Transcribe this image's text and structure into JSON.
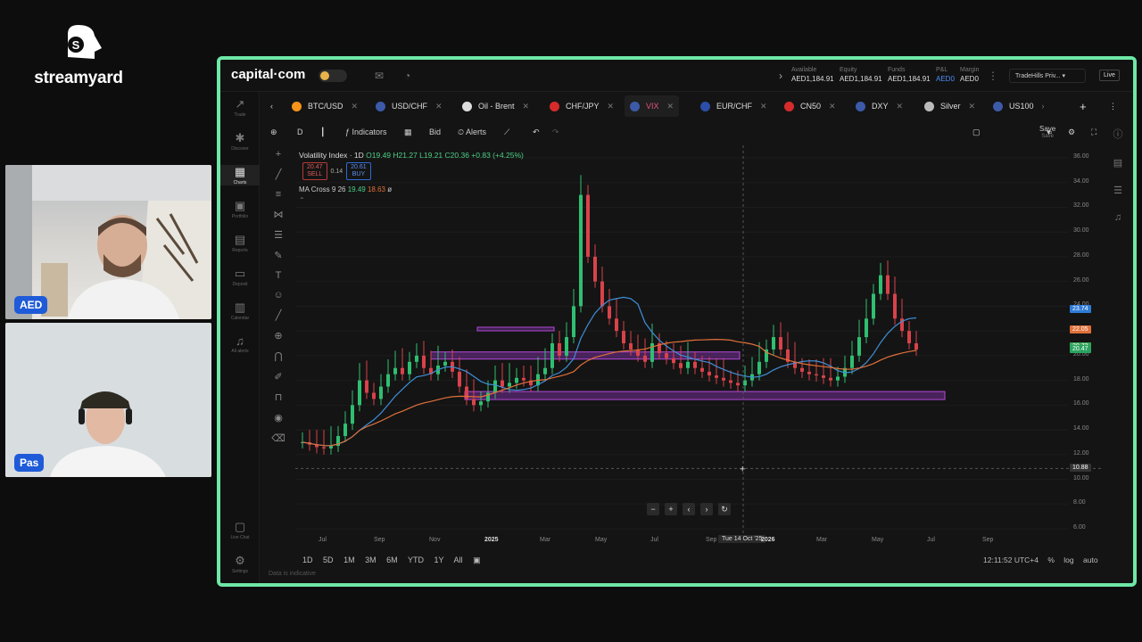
{
  "streamyard": {
    "brand_text": "streamyard",
    "participants": [
      {
        "badge": "AED"
      },
      {
        "badge": "Pas"
      }
    ]
  },
  "app": {
    "brand": "capital·com",
    "account": {
      "available_label": "Available",
      "available_value": "AED1,184.91",
      "equity_label": "Equity",
      "equity_value": "AED1,184.91",
      "funds_label": "Funds",
      "funds_value": "AED1,184.91",
      "pnl_label": "P&L",
      "pnl_value": "AED0",
      "margin_label": "Margin",
      "margin_value": "AED0"
    },
    "account_selector": "TradeHills Priv...",
    "live_badge": "Live"
  },
  "sidebar": {
    "items": [
      {
        "label": "Trade",
        "icon": "trend-up-icon"
      },
      {
        "label": "Discover",
        "icon": "network-icon"
      },
      {
        "label": "Charts",
        "icon": "charts-icon"
      },
      {
        "label": "Portfolio",
        "icon": "briefcase-icon"
      },
      {
        "label": "Reports",
        "icon": "report-icon"
      },
      {
        "label": "Deposit",
        "icon": "wallet-icon"
      },
      {
        "label": "Calendar",
        "icon": "calendar-icon"
      },
      {
        "label": "All alerts",
        "icon": "bell-icon"
      },
      {
        "label": "Live Chat",
        "icon": "chat-icon"
      },
      {
        "label": "Settings",
        "icon": "gear-icon"
      }
    ]
  },
  "tabs": [
    {
      "label": "BTC/USD",
      "color": "#f7931a"
    },
    {
      "label": "USD/CHF",
      "color": "#3c5aa8"
    },
    {
      "label": "Oil - Brent",
      "color": "#dddddd"
    },
    {
      "label": "CHF/JPY",
      "color": "#d62b2b"
    },
    {
      "label": "VIX",
      "color": "#3c5aa8"
    },
    {
      "label": "EUR/CHF",
      "color": "#2c4ea8"
    },
    {
      "label": "CN50",
      "color": "#d62b2b"
    },
    {
      "label": "DXY",
      "color": "#3c5aa8"
    },
    {
      "label": "Silver",
      "color": "#bbbbbb"
    },
    {
      "label": "US100",
      "color": "#3c5aa8"
    }
  ],
  "toolbar": {
    "interval": "D",
    "indicators": "Indicators",
    "price_type": "Bid",
    "alerts": "Alerts",
    "save": "Save",
    "save_sub": "Save"
  },
  "legend": {
    "title": "Volatility Index · 1D",
    "ohlc": "O19.49 H21.27 L19.21 C20.36 +0.83 (+4.25%)",
    "sell_price": "20.47",
    "sell_label": "SELL",
    "spread": "0.14",
    "buy_price": "20.61",
    "buy_label": "BUY",
    "ma_label": "MA Cross 9 26",
    "ma_fast": "19.49",
    "ma_slow": "18.63"
  },
  "chart_data": {
    "type": "candlestick",
    "instrument": "Volatility Index",
    "interval": "1D",
    "y_ticks": [
      "36.00",
      "34.00",
      "32.00",
      "30.00",
      "28.00",
      "26.00",
      "24.00",
      "22.00",
      "20.00",
      "18.00",
      "16.00",
      "14.00",
      "12.00",
      "10.00",
      "8.00",
      "6.00"
    ],
    "ylim": [
      6,
      36
    ],
    "x_ticks": [
      "Jul",
      "Sep",
      "Nov",
      "2025",
      "Mar",
      "May",
      "Jul",
      "Sep",
      "2026",
      "Mar",
      "May",
      "Jul",
      "Sep"
    ],
    "crosshair_date": "Tue 14 Oct '25",
    "crosshair_price": "10.88",
    "price_labels": [
      {
        "value": "23.74",
        "color": "#2e7bd6"
      },
      {
        "value": "22.05",
        "color": "#e0703a"
      },
      {
        "value": "20.73",
        "color": "#3aa655"
      },
      {
        "value": "20.47",
        "color": "#2aa35f"
      }
    ],
    "series": [
      {
        "name": "MA 9",
        "color": "#3f8fd8"
      },
      {
        "name": "MA 26",
        "color": "#e0703a"
      }
    ],
    "closes": [
      13,
      12.8,
      12.6,
      12.5,
      12.7,
      13.5,
      14.5,
      16,
      18,
      17,
      16.5,
      17.5,
      18.5,
      19,
      18.5,
      19.5,
      20,
      19,
      18.5,
      19.2,
      19.5,
      18.7,
      17.5,
      16.5,
      16,
      16.3,
      17,
      18,
      17.5,
      17.8,
      18.2,
      18,
      17.6,
      18.5,
      19,
      21,
      20,
      21.5,
      24,
      33,
      28,
      26,
      24,
      23,
      22,
      21,
      20.5,
      20,
      19.5,
      21,
      20.2,
      19.8,
      19.4,
      19,
      19.5,
      19,
      18.7,
      18.4,
      18.2,
      18,
      17.8,
      17.6,
      18,
      18.5,
      19.5,
      20.5,
      21.5,
      20.5,
      19.5,
      19,
      18.7,
      18.5,
      18.4,
      18.2,
      18,
      18.3,
      19,
      20,
      21.5,
      23,
      25,
      26.5,
      25,
      23,
      22,
      21,
      20.5
    ]
  },
  "zoom_controls": [
    "−",
    "+",
    "‹",
    "›",
    "↻"
  ],
  "ranges": [
    "1D",
    "5D",
    "1M",
    "3M",
    "6M",
    "YTD",
    "1Y",
    "All"
  ],
  "footer": {
    "time": "12:11:52 UTC+4",
    "pct": "%",
    "log": "log",
    "auto": "auto",
    "disclaimer": "Data is indicative"
  }
}
